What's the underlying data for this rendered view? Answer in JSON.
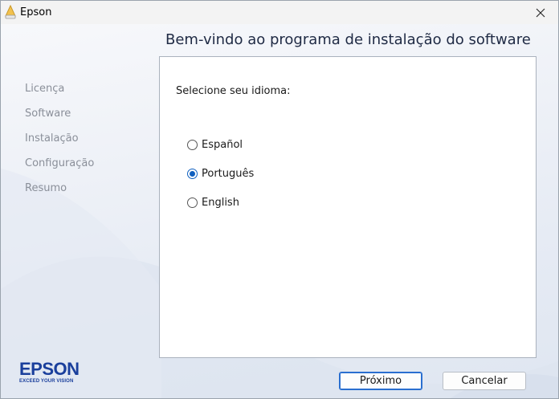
{
  "window": {
    "title": "Epson",
    "close_glyph": "✕"
  },
  "header": {
    "title": "Bem-vindo ao programa de instalação do software"
  },
  "sidebar": {
    "steps": [
      {
        "label": "Licença"
      },
      {
        "label": "Software"
      },
      {
        "label": "Instalação"
      },
      {
        "label": "Configuração"
      },
      {
        "label": "Resumo"
      }
    ]
  },
  "language": {
    "prompt": "Selecione seu idioma:",
    "options": [
      {
        "label": "Español",
        "selected": false
      },
      {
        "label": "Português",
        "selected": true
      },
      {
        "label": "English",
        "selected": false
      }
    ]
  },
  "brand": {
    "logo_text": "EPSON",
    "tagline": "EXCEED YOUR VISION",
    "color": "#1a3f9c"
  },
  "buttons": {
    "next_label": "Próximo",
    "cancel_label": "Cancelar"
  },
  "colors": {
    "accent": "#0f5fbf",
    "default_button_border": "#2a6fd0"
  }
}
